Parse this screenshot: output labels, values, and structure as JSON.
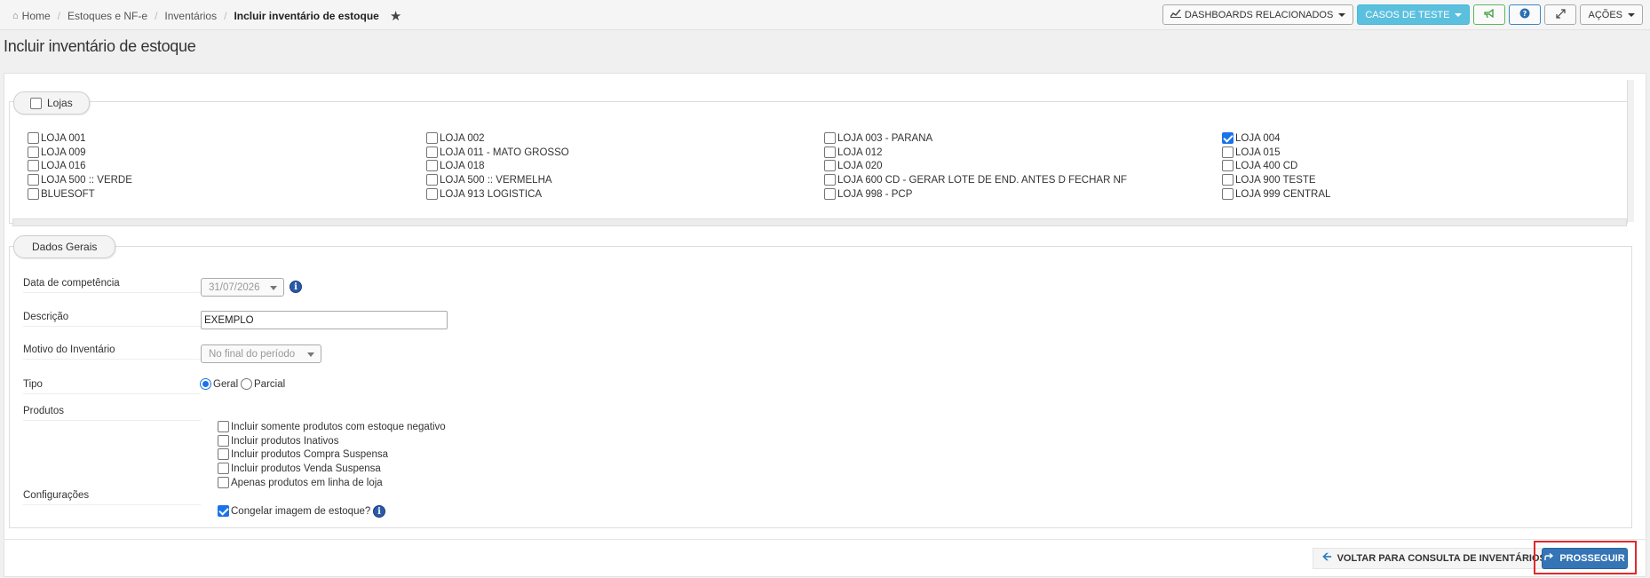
{
  "breadcrumb": {
    "home": "Home",
    "items": [
      "Estoques e NF-e",
      "Inventários"
    ],
    "current": "Incluir inventário de estoque"
  },
  "toolbar": {
    "dashboards_label": "DASHBOARDS RELACIONADOS",
    "casos_label": "CASOS DE TESTE",
    "acoes_label": "AÇÕES"
  },
  "page": {
    "title": "Incluir inventário de estoque"
  },
  "lojas": {
    "legend": "Lojas",
    "columns": [
      [
        {
          "label": "LOJA 001",
          "checked": false
        },
        {
          "label": "LOJA 009",
          "checked": false
        },
        {
          "label": "LOJA 016",
          "checked": false
        },
        {
          "label": "LOJA 500 :: VERDE",
          "checked": false
        },
        {
          "label": "BLUESOFT",
          "checked": false
        }
      ],
      [
        {
          "label": "LOJA 002",
          "checked": false
        },
        {
          "label": "LOJA 011 - MATO GROSSO",
          "checked": false
        },
        {
          "label": "LOJA 018",
          "checked": false
        },
        {
          "label": "LOJA 500 :: VERMELHA",
          "checked": false
        },
        {
          "label": "LOJA 913 LOGISTICA",
          "checked": false
        }
      ],
      [
        {
          "label": "LOJA 003 - PARANA",
          "checked": false
        },
        {
          "label": "LOJA 012",
          "checked": false
        },
        {
          "label": "LOJA 020",
          "checked": false
        },
        {
          "label": "LOJA 600 CD - GERAR LOTE DE END. ANTES D FECHAR NF",
          "checked": false
        },
        {
          "label": "LOJA 998 - PCP",
          "checked": false
        }
      ],
      [
        {
          "label": "LOJA 004",
          "checked": true
        },
        {
          "label": "LOJA 015",
          "checked": false
        },
        {
          "label": "LOJA 400 CD",
          "checked": false
        },
        {
          "label": "LOJA 900 TESTE",
          "checked": false
        },
        {
          "label": "LOJA 999 CENTRAL",
          "checked": false
        }
      ]
    ]
  },
  "dados_gerais": {
    "legend": "Dados Gerais",
    "data_competencia": {
      "label": "Data de competência",
      "value": "31/07/2026"
    },
    "descricao": {
      "label": "Descrição",
      "value": "EXEMPLO"
    },
    "motivo": {
      "label": "Motivo do Inventário",
      "value": "No final do período"
    },
    "tipo": {
      "label": "Tipo",
      "options": [
        "Geral",
        "Parcial"
      ],
      "selected": "Geral"
    },
    "produtos": {
      "label": "Produtos",
      "options": [
        {
          "label": "Incluir somente produtos com estoque negativo",
          "checked": false
        },
        {
          "label": "Incluir produtos Inativos",
          "checked": false
        },
        {
          "label": "Incluir produtos Compra Suspensa",
          "checked": false
        },
        {
          "label": "Incluir produtos Venda Suspensa",
          "checked": false
        },
        {
          "label": "Apenas produtos em linha de loja",
          "checked": false
        }
      ]
    },
    "configuracoes": {
      "label": "Configurações",
      "congelar": {
        "label": "Congelar imagem de estoque?",
        "checked": true
      }
    }
  },
  "footer": {
    "back_label": "VOLTAR PARA CONSULTA DE INVENTÁRIOS",
    "next_label": "PROSSEGUIR"
  },
  "colors": {
    "primary": "#3575b5",
    "info": "#5bc0de",
    "checkbox": "#1a73e8",
    "highlight": "#e0282e"
  }
}
